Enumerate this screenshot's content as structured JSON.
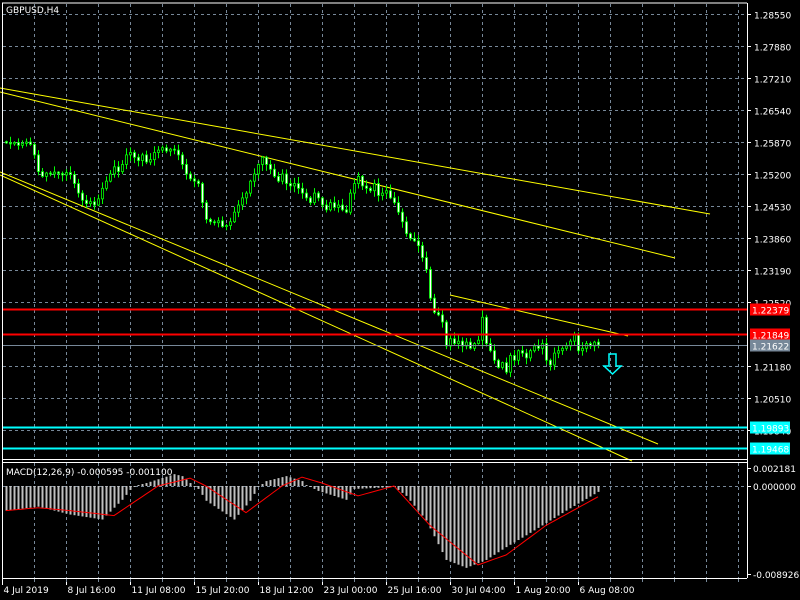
{
  "window": {
    "symbol_title": "GBPUSD,H4"
  },
  "colors": {
    "background": "#000000",
    "grid": "#778899",
    "axis": "#ffffff",
    "candle_wick": "#00ff00",
    "bull_body": "#000000",
    "bear_body": "#ffffff",
    "trendline": "#ffff00",
    "resistance": "#ff0000",
    "support": "#00ffff",
    "bid": "#778899",
    "macd_hist": "#c0c0c0",
    "macd_signal": "#ff0000"
  },
  "price_axis": {
    "ticks": [
      "1.28550",
      "1.27880",
      "1.27210",
      "1.26540",
      "1.25870",
      "1.25200",
      "1.24530",
      "1.23860",
      "1.23190",
      "1.22520",
      "1.21180",
      "1.20510",
      "1.19840"
    ]
  },
  "time_axis": {
    "labels": [
      "4 Jul 2019",
      "8 Jul 16:00",
      "11 Jul 08:00",
      "15 Jul 20:00",
      "18 Jul 12:00",
      "23 Jul 00:00",
      "25 Jul 16:00",
      "30 Jul 04:00",
      "1 Aug 20:00",
      "6 Aug 08:00"
    ]
  },
  "horizontal_lines": [
    {
      "price": 1.22379,
      "label": "1.22379",
      "kind": "resistance"
    },
    {
      "price": 1.21849,
      "label": "1.21849",
      "kind": "resistance"
    },
    {
      "price": 1.21622,
      "label": "1.21622",
      "kind": "bid"
    },
    {
      "price": 1.19893,
      "label": "1.19893",
      "kind": "support"
    },
    {
      "price": 1.19468,
      "label": "1.19468",
      "kind": "support"
    }
  ],
  "signal_arrow": {
    "icon": "down-arrow-icon",
    "direction": "down"
  },
  "macd": {
    "title": "MACD(12,26,9) -0.000595 -0.001100",
    "axis_labels": [
      "0.002181",
      "0.000000",
      "-0.008926"
    ],
    "main_keyframes": [
      [
        0,
        -0.0025
      ],
      [
        8,
        -0.0021
      ],
      [
        16,
        -0.0029
      ],
      [
        24,
        -0.0034
      ],
      [
        29,
        -0.0014
      ],
      [
        31,
        -0.0004
      ],
      [
        32,
        0
      ],
      [
        35,
        0.0003
      ],
      [
        42,
        0.0012
      ],
      [
        44,
        0.001
      ],
      [
        46,
        0.0003
      ],
      [
        48,
        -0.0003
      ],
      [
        50,
        -0.0015
      ],
      [
        57,
        -0.0034
      ],
      [
        61,
        -0.0015
      ],
      [
        63,
        -0.0001
      ],
      [
        65,
        0.0005
      ],
      [
        70,
        0.001
      ],
      [
        74,
        0.0005
      ],
      [
        75,
        0.0001
      ],
      [
        78,
        -0.0005
      ],
      [
        85,
        -0.0014
      ],
      [
        87,
        -0.0003
      ],
      [
        97,
        -0.0001
      ],
      [
        100,
        -0.001
      ],
      [
        105,
        -0.0035
      ],
      [
        110,
        -0.0075
      ],
      [
        115,
        -0.0083
      ],
      [
        120,
        -0.0075
      ],
      [
        125,
        -0.0062
      ],
      [
        130,
        -0.005
      ],
      [
        140,
        -0.0025
      ],
      [
        148,
        -0.000595
      ]
    ],
    "signal_keyframes": [
      [
        0,
        -0.0025
      ],
      [
        8,
        -0.0022
      ],
      [
        16,
        -0.0025
      ],
      [
        27,
        -0.003
      ],
      [
        38,
        0
      ],
      [
        46,
        0.0008
      ],
      [
        50,
        0
      ],
      [
        60,
        -0.0027
      ],
      [
        69,
        0
      ],
      [
        74,
        0.0009
      ],
      [
        79,
        0.0003
      ],
      [
        88,
        -0.001
      ],
      [
        97,
        0
      ],
      [
        106,
        -0.004
      ],
      [
        118,
        -0.008
      ],
      [
        125,
        -0.007
      ],
      [
        135,
        -0.004
      ],
      [
        148,
        -0.0011
      ]
    ]
  },
  "candles_close": [
    1.2585,
    1.2583,
    1.2586,
    1.258,
    1.2584,
    1.2587,
    1.2582,
    1.256,
    1.2525,
    1.2515,
    1.2522,
    1.252,
    1.2524,
    1.2521,
    1.2518,
    1.2523,
    1.2519,
    1.25,
    1.248,
    1.2465,
    1.2458,
    1.2462,
    1.2455,
    1.2468,
    1.249,
    1.2505,
    1.252,
    1.2535,
    1.2525,
    1.254,
    1.256,
    1.2565,
    1.2555,
    1.2548,
    1.256,
    1.2545,
    1.255,
    1.2565,
    1.257,
    1.2575,
    1.2568,
    1.2572,
    1.257,
    1.256,
    1.254,
    1.252,
    1.251,
    1.2505,
    1.25,
    1.246,
    1.2425,
    1.242,
    1.2418,
    1.2422,
    1.241,
    1.2412,
    1.242,
    1.244,
    1.2455,
    1.247,
    1.248,
    1.2505,
    1.252,
    1.254,
    1.2555,
    1.254,
    1.253,
    1.2515,
    1.2505,
    1.252,
    1.25,
    1.2495,
    1.25,
    1.249,
    1.248,
    1.247,
    1.246,
    1.248,
    1.247,
    1.2455,
    1.2445,
    1.246,
    1.245,
    1.2455,
    1.2445,
    1.244,
    1.248,
    1.25,
    1.2515,
    1.2495,
    1.249,
    1.2485,
    1.25,
    1.2475,
    1.248,
    1.2485,
    1.247,
    1.246,
    1.244,
    1.242,
    1.2395,
    1.2385,
    1.238,
    1.237,
    1.2345,
    1.232,
    1.226,
    1.223,
    1.2225,
    1.221,
    1.216,
    1.2175,
    1.2165,
    1.217,
    1.216,
    1.2168,
    1.2155,
    1.2165,
    1.2172,
    1.222,
    1.2165,
    1.215,
    1.213,
    1.2115,
    1.2125,
    1.2105,
    1.214,
    1.213,
    1.215,
    1.2145,
    1.2135,
    1.215,
    1.216,
    1.2155,
    1.2165,
    1.213,
    1.212,
    1.2145,
    1.215,
    1.2155,
    1.216,
    1.217,
    1.2185,
    1.215,
    1.2155,
    1.2165,
    1.216,
    1.2168,
    1.2162
  ]
}
